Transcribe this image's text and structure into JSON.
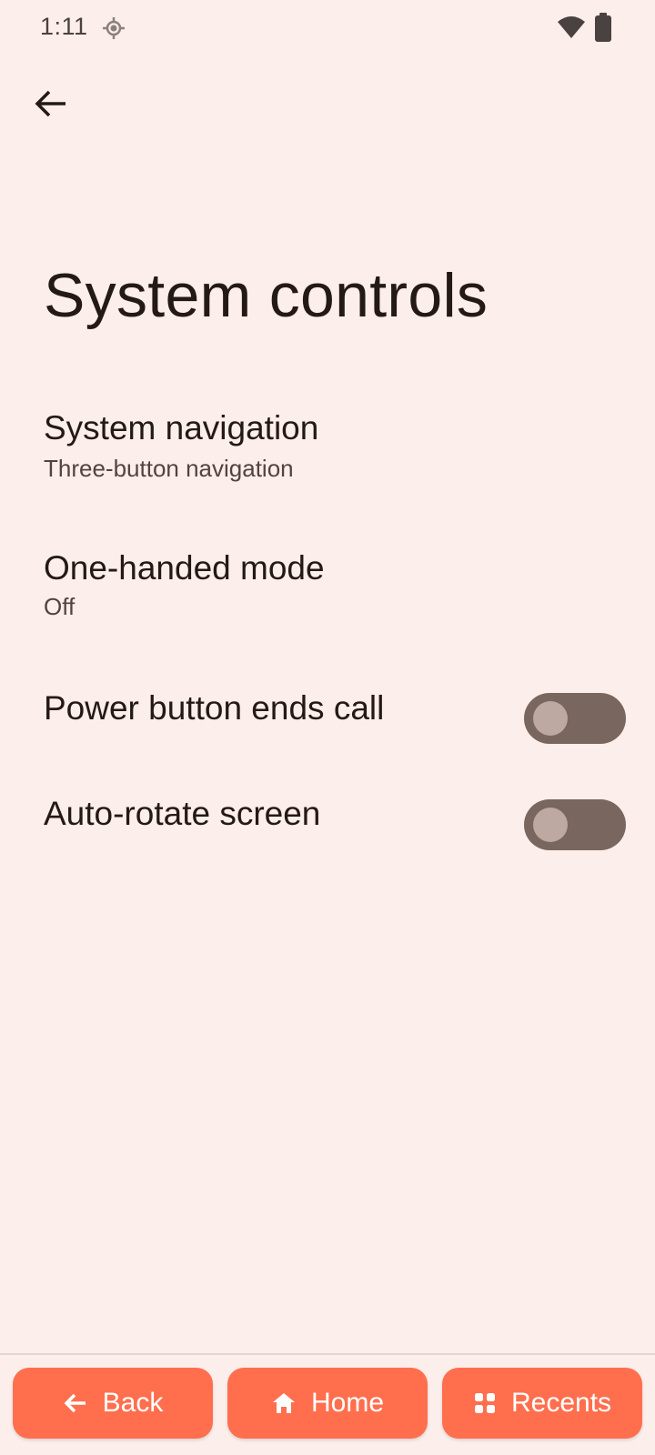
{
  "status_bar": {
    "time": "1:11",
    "icons": [
      "location-icon",
      "wifi-icon",
      "battery-icon"
    ]
  },
  "header": {
    "back_icon": "arrow-back-icon"
  },
  "page": {
    "title": "System controls"
  },
  "settings": [
    {
      "title": "System navigation",
      "summary": "Three-button navigation"
    },
    {
      "title": "One-handed mode",
      "summary": "Off"
    },
    {
      "title": "Power button ends call",
      "toggle": false
    },
    {
      "title": "Auto-rotate screen",
      "toggle": false
    }
  ],
  "nav": {
    "back_label": "Back",
    "home_label": "Home",
    "recents_label": "Recents"
  },
  "colors": {
    "background": "#FCEEEA",
    "nav_button": "#FF6F4E",
    "toggle_track": "#78665f",
    "toggle_thumb": "#bda8a2",
    "text_primary": "#231917",
    "text_secondary": "#53433f"
  }
}
